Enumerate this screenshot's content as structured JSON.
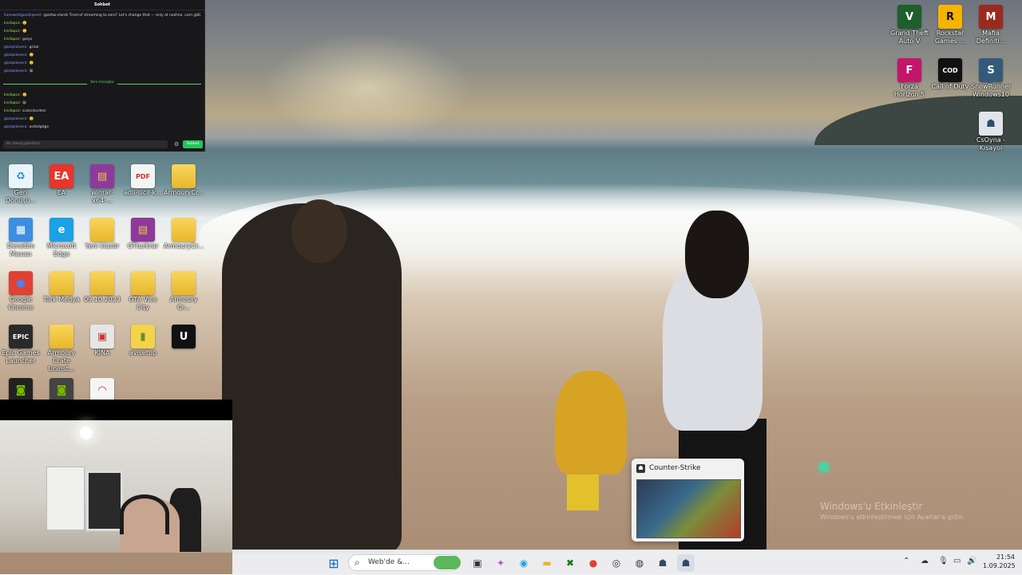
{
  "chat": {
    "title": "Sohbet",
    "lines": [
      {
        "user": "lionswestgoodspeed",
        "msg": "@zzhw-clerds Tired of streaming to zero? Let's change that — only at nezhno .com @82C3!",
        "blue": true
      },
      {
        "user": "kivilapcz",
        "msg": "🙂",
        "blue": false
      },
      {
        "user": "kivilapcz",
        "msg": "🙂",
        "blue": false
      },
      {
        "user": "kivilapcz",
        "msg": "gaiyo",
        "blue": false
      },
      {
        "user": "gzzeplaiverz",
        "msg": "grizzi",
        "blue": true
      },
      {
        "user": "gzzeplaiverz",
        "msg": "🙂",
        "blue": true
      },
      {
        "user": "gzzeplaiverz",
        "msg": "🙂",
        "blue": true
      },
      {
        "user": "gzzeplaiverz",
        "msg": "😀",
        "blue": true
      }
    ],
    "separator": "Yeni mesajlar",
    "lines2": [
      {
        "user": "kivilapcz",
        "msg": "🙂",
        "blue": false
      },
      {
        "user": "kivilapcz",
        "msg": "😀",
        "blue": false
      },
      {
        "user": "kivilapcz",
        "msg": "sczecdscdesr",
        "blue": false
      },
      {
        "user": "gzzeplaiverz",
        "msg": "🙂",
        "blue": true
      },
      {
        "user": "gzzeplaiverz",
        "msg": "asdsdgdge",
        "blue": true
      }
    ],
    "input_placeholder": "Bir mesaj gönderin",
    "send_label": "Sohbet"
  },
  "desktop_icons": [
    {
      "label": "Geri Dönüşü...",
      "icon": "recycle-bin-icon",
      "glyph": "♻",
      "bg": "#e9f4fb",
      "fg": "#2b8ad8"
    },
    {
      "label": "EA",
      "icon": "ea-icon",
      "glyph": "EA",
      "bg": "#e8352b",
      "fg": "#fff"
    },
    {
      "label": "winrar-x64-...",
      "icon": "winrar-icon",
      "glyph": "▤",
      "bg": "#8e3a9b",
      "fg": "#f4c542"
    },
    {
      "label": "adli-sicil-k...",
      "icon": "pdf-icon",
      "glyph": "PDF",
      "bg": "#f4f4f4",
      "fg": "#d62b2b"
    },
    {
      "label": "ArmouryCr...",
      "icon": "archive-folder-icon",
      "glyph": "",
      "bg": "folder",
      "fg": "#fff"
    },
    {
      "label": "Denetim Masası",
      "icon": "control-panel-icon",
      "glyph": "▦",
      "bg": "#3d8ee0",
      "fg": "#fff"
    },
    {
      "label": "Microsoft Edge",
      "icon": "edge-icon",
      "glyph": "e",
      "bg": "#1aa1e6",
      "fg": "#fff"
    },
    {
      "label": "Yeni klasör",
      "icon": "folder-icon",
      "glyph": "",
      "bg": "folder",
      "fg": "#fff"
    },
    {
      "label": "GTturkrar",
      "icon": "winrar-icon",
      "glyph": "▤",
      "bg": "#8e3a9b",
      "fg": "#f4c542"
    },
    {
      "label": "ArmouryCr...",
      "icon": "folder-icon",
      "glyph": "",
      "bg": "folder",
      "fg": "#fff"
    },
    {
      "label": "Google Chrome",
      "icon": "chrome-icon",
      "glyph": "●",
      "bg": "#e04134",
      "fg": "#4285f4"
    },
    {
      "label": "Türk Medya",
      "icon": "folder-icon",
      "glyph": "",
      "bg": "folder",
      "fg": "#fff"
    },
    {
      "label": "09.10.2023",
      "icon": "folder-icon",
      "glyph": "",
      "bg": "folder",
      "fg": "#fff"
    },
    {
      "label": "GTA Vice City",
      "icon": "folder-icon",
      "glyph": "",
      "bg": "folder",
      "fg": "#fff"
    },
    {
      "label": "Armoury Cr...",
      "icon": "archive-folder-icon",
      "glyph": "",
      "bg": "folder",
      "fg": "#fff"
    },
    {
      "label": "Epic Games Launcher",
      "icon": "epic-games-icon",
      "glyph": "EPIC",
      "bg": "#2a2a2a",
      "fg": "#fff"
    },
    {
      "label": "Armoury Crate Uninst...",
      "icon": "folder-icon",
      "glyph": "",
      "bg": "folder",
      "fg": "#fff"
    },
    {
      "label": "KİNA",
      "icon": "folder-icon",
      "glyph": "▣",
      "bg": "#e6e6e6",
      "fg": "#c33"
    },
    {
      "label": "avisetup",
      "icon": "setup-icon",
      "glyph": "▮",
      "bg": "#f3d34a",
      "fg": "#6b8f2a"
    },
    {
      "label": "",
      "icon": "unreal-icon",
      "glyph": "U",
      "bg": "#111",
      "fg": "#fff"
    },
    {
      "label": "",
      "icon": "nvidia-icon",
      "glyph": "◙",
      "bg": "#222",
      "fg": "#76b900"
    },
    {
      "label": "",
      "icon": "nvidia-icon",
      "glyph": "◙",
      "bg": "#444",
      "fg": "#76b900"
    },
    {
      "label": "",
      "icon": "app-icon",
      "glyph": "◠",
      "bg": "#f5f5f5",
      "fg": "#d22"
    }
  ],
  "right_icons": [
    {
      "label": "Grand Theft Auto V",
      "icon": "gta-icon",
      "glyph": "V",
      "bg": "#1f5e2d",
      "fg": "#fff"
    },
    {
      "label": "Rockstar Games ...",
      "icon": "rockstar-icon",
      "glyph": "R",
      "bg": "#f6b400",
      "fg": "#111"
    },
    {
      "label": "Mafia Definiti...",
      "icon": "mafia-icon",
      "glyph": "M",
      "bg": "#9b2a1e",
      "fg": "#fff"
    },
    {
      "label": "Forza Horizon 5",
      "icon": "forza-icon",
      "glyph": "F",
      "bg": "#c3166a",
      "fg": "#fff"
    },
    {
      "label": "Call of Duty",
      "icon": "cod-icon",
      "glyph": "COD",
      "bg": "#111",
      "fg": "#fff"
    },
    {
      "label": "SnowRunner Windows10",
      "icon": "snowrunner-icon",
      "glyph": "S",
      "bg": "#345a7a",
      "fg": "#fff"
    },
    {
      "label": "CsOyna - Kısayol",
      "icon": "counter-strike-icon",
      "glyph": "☗",
      "bg": "#dfe5ea",
      "fg": "#2f4a6b"
    }
  ],
  "thumbnail": {
    "title": "Counter-Strike"
  },
  "watermark": {
    "line1": "Windows'u Etkinleştir",
    "line2": "Windows'u etkinleştirmek için Ayarlar'a gidin."
  },
  "taskbar": {
    "search_placeholder": "Web'de &...",
    "time": "21:54",
    "date": "1.09.2025"
  }
}
